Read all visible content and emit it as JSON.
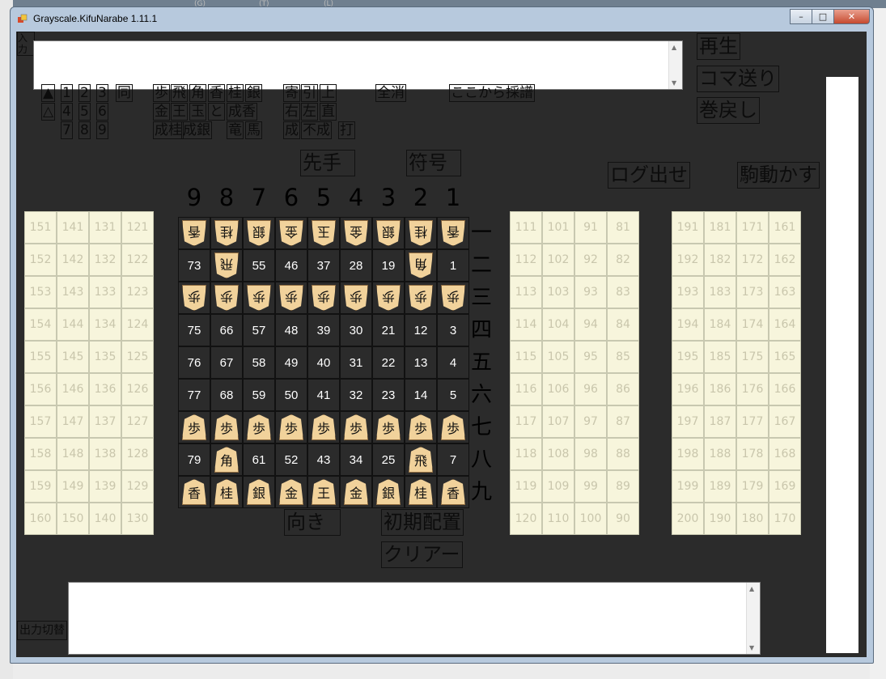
{
  "window": {
    "title": "Grayscale.KifuNarabe 1.11.1",
    "minimize": "–",
    "maximize": "□",
    "close": "✕"
  },
  "desktop": {
    "strip_labels": [
      "(G)",
      "(T)",
      "(L)"
    ]
  },
  "top_buttons": {
    "replay": "再生",
    "step_forward": "コマ送り",
    "rewind": "巻戻し",
    "input_label": "入力"
  },
  "keypad": {
    "sente_mark": "▲",
    "gote_mark": "△",
    "digits_row1": [
      "1",
      "2",
      "3"
    ],
    "digits_row2": [
      "4",
      "5",
      "6"
    ],
    "digits_row3": [
      "7",
      "8",
      "9"
    ],
    "same": "同"
  },
  "piece_buttons": {
    "row1": [
      "歩",
      "飛",
      "角",
      "香",
      "桂",
      "銀"
    ],
    "row2": [
      "金",
      "王",
      "玉",
      "と",
      "成香"
    ],
    "row3": [
      "成桂",
      "成銀",
      "竜",
      "馬"
    ]
  },
  "move_modifiers": {
    "row1": [
      "寄",
      "引",
      "上"
    ],
    "row2": [
      "右",
      "左",
      "直"
    ],
    "row3": [
      "成",
      "不成",
      "打"
    ]
  },
  "edit_buttons": {
    "clear_all": "全消",
    "record_from_here": "ここから採譜",
    "sente": "先手",
    "notation": "符号",
    "log_output": "ログ出せ",
    "move_piece": "駒動かす",
    "direction": "向き",
    "initial_setup": "初期配置",
    "clear": "クリアー",
    "output_toggle": "出力切替"
  },
  "board_labels": {
    "columns": [
      "9",
      "8",
      "7",
      "6",
      "5",
      "4",
      "3",
      "2",
      "1"
    ],
    "rows": [
      "一",
      "二",
      "三",
      "四",
      "五",
      "六",
      "七",
      "八",
      "九"
    ]
  },
  "board_rows": [
    [
      {
        "p": "香",
        "g": true
      },
      {
        "p": "桂",
        "g": true
      },
      {
        "p": "銀",
        "g": true
      },
      {
        "p": "金",
        "g": true
      },
      {
        "p": "玉",
        "g": true
      },
      {
        "p": "金",
        "g": true
      },
      {
        "p": "銀",
        "g": true
      },
      {
        "p": "桂",
        "g": true
      },
      {
        "p": "香",
        "g": true
      }
    ],
    [
      "73",
      {
        "p": "飛",
        "g": true
      },
      "55",
      "46",
      "37",
      "28",
      "19",
      {
        "p": "角",
        "g": true
      },
      "1"
    ],
    [
      {
        "p": "歩",
        "g": true
      },
      {
        "p": "歩",
        "g": true
      },
      {
        "p": "歩",
        "g": true
      },
      {
        "p": "歩",
        "g": true
      },
      {
        "p": "歩",
        "g": true
      },
      {
        "p": "歩",
        "g": true
      },
      {
        "p": "歩",
        "g": true
      },
      {
        "p": "歩",
        "g": true
      },
      {
        "p": "歩",
        "g": true
      }
    ],
    [
      "75",
      "66",
      "57",
      "48",
      "39",
      "30",
      "21",
      "12",
      "3"
    ],
    [
      "76",
      "67",
      "58",
      "49",
      "40",
      "31",
      "22",
      "13",
      "4"
    ],
    [
      "77",
      "68",
      "59",
      "50",
      "41",
      "32",
      "23",
      "14",
      "5"
    ],
    [
      {
        "p": "歩"
      },
      {
        "p": "歩"
      },
      {
        "p": "歩"
      },
      {
        "p": "歩"
      },
      {
        "p": "歩"
      },
      {
        "p": "歩"
      },
      {
        "p": "歩"
      },
      {
        "p": "歩"
      },
      {
        "p": "歩"
      }
    ],
    [
      "79",
      {
        "p": "角"
      },
      "61",
      "52",
      "43",
      "34",
      "25",
      {
        "p": "飛"
      },
      "7"
    ],
    [
      {
        "p": "香"
      },
      {
        "p": "桂"
      },
      {
        "p": "銀"
      },
      {
        "p": "金"
      },
      {
        "p": "王"
      },
      {
        "p": "金"
      },
      {
        "p": "銀"
      },
      {
        "p": "桂"
      },
      {
        "p": "香"
      }
    ]
  ],
  "stands": {
    "left": [
      [
        "151",
        "141",
        "131",
        "121"
      ],
      [
        "152",
        "142",
        "132",
        "122"
      ],
      [
        "153",
        "143",
        "133",
        "123"
      ],
      [
        "154",
        "144",
        "134",
        "124"
      ],
      [
        "155",
        "145",
        "135",
        "125"
      ],
      [
        "156",
        "146",
        "136",
        "126"
      ],
      [
        "157",
        "147",
        "137",
        "127"
      ],
      [
        "158",
        "148",
        "138",
        "128"
      ],
      [
        "159",
        "149",
        "139",
        "129"
      ],
      [
        "160",
        "150",
        "140",
        "130"
      ]
    ],
    "middle": [
      [
        "111",
        "101",
        "91",
        "81"
      ],
      [
        "112",
        "102",
        "92",
        "82"
      ],
      [
        "113",
        "103",
        "93",
        "83"
      ],
      [
        "114",
        "104",
        "94",
        "84"
      ],
      [
        "115",
        "105",
        "95",
        "85"
      ],
      [
        "116",
        "106",
        "96",
        "86"
      ],
      [
        "117",
        "107",
        "97",
        "87"
      ],
      [
        "118",
        "108",
        "98",
        "88"
      ],
      [
        "119",
        "109",
        "99",
        "89"
      ],
      [
        "120",
        "110",
        "100",
        "90"
      ]
    ],
    "right": [
      [
        "191",
        "181",
        "171",
        "161"
      ],
      [
        "192",
        "182",
        "172",
        "162"
      ],
      [
        "193",
        "183",
        "173",
        "163"
      ],
      [
        "194",
        "184",
        "174",
        "164"
      ],
      [
        "195",
        "185",
        "175",
        "165"
      ],
      [
        "196",
        "186",
        "176",
        "166"
      ],
      [
        "197",
        "187",
        "177",
        "167"
      ],
      [
        "198",
        "188",
        "178",
        "168"
      ],
      [
        "199",
        "189",
        "179",
        "169"
      ],
      [
        "200",
        "190",
        "180",
        "170"
      ]
    ]
  }
}
